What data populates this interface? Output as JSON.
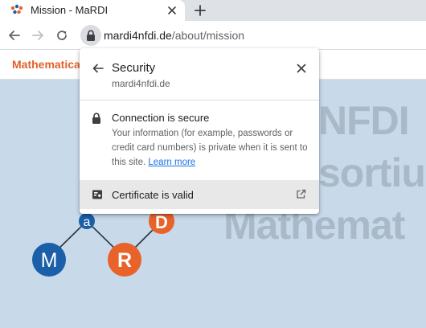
{
  "browser": {
    "tab": {
      "title": "Mission - MaRDI",
      "favicon": "mardi-favicon-icon"
    },
    "new_tab_icon": "plus-icon",
    "nav": {
      "back": "arrow-left-icon",
      "forward": "arrow-right-icon",
      "reload": "reload-icon"
    },
    "address": {
      "host": "mardi4nfdi.de",
      "path": "/about/mission",
      "security_icon": "lock-icon"
    }
  },
  "page": {
    "header_title": "Mathematica",
    "hero_lines": [
      "NFDI",
      "sortiu",
      "Mathemat"
    ],
    "logo": {
      "letters": [
        "M",
        "a",
        "R",
        "D"
      ],
      "colors": {
        "blue": "#1a5fa8",
        "orange": "#e8622a"
      }
    }
  },
  "security_popup": {
    "title": "Security",
    "host": "mardi4nfdi.de",
    "connection_title": "Connection is secure",
    "connection_description": "Your information (for example, passwords or credit card numbers) is private when it is sent to this site.",
    "learn_more": "Learn more",
    "certificate_label": "Certificate is valid"
  }
}
